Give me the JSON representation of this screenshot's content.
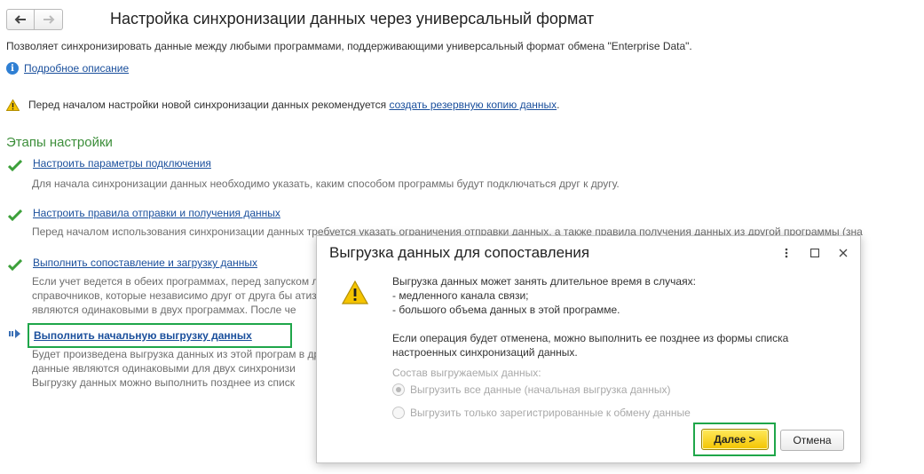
{
  "header": {
    "title": "Настройка синхронизации данных через универсальный формат",
    "description": "Позволяет синхронизировать данные между любыми программами, поддерживающими универсальный формат обмена \"Enterprise Data\".",
    "details_link": "Подробное описание"
  },
  "warning": {
    "text_before": "Перед началом настройки новой синхронизации данных рекомендуется ",
    "link": "создать резервную копию данных",
    "text_after": "."
  },
  "stages": {
    "title": "Этапы настройки",
    "items": [
      {
        "link": "Настроить параметры подключения",
        "lines": [
          "Для начала синхронизации данных необходимо указать, каким способом программы будут подключаться друг к другу."
        ]
      },
      {
        "link": "Настроить правила отправки и получения данных",
        "lines": [
          "Перед началом использования синхронизации данных требуется указать ограничения отправки данных, а также правила получения данных из другой программы (зна"
        ]
      },
      {
        "link": "Выполнить сопоставление и загрузку данных",
        "lines": [
          "Если учет ведется в обеих программах, перед запуском                                                                                               лирующихс",
          "справочников, которые независимо друг от друга бы                                                                                                 атизации можно",
          "являются одинаковыми в двух программах. После че"
        ]
      },
      {
        "link": "Выполнить начальную выгрузку данных",
        "lines": [
          "Будет произведена выгрузка данных из этой програм                                                                                                 в другой пр",
          "данные являются одинаковыми для двух синхронизи",
          "Выгрузку данных можно выполнить позднее из списк"
        ]
      }
    ]
  },
  "dialog": {
    "title": "Выгрузка данных для сопоставления",
    "message_lines": [
      "Выгрузка данных может занять длительное время в случаях:",
      " - медленного канала связи;",
      " - большого объема данных в этой программе."
    ],
    "message2_lines": [
      "Если операция будет отменена, можно выполнить ее позднее из формы списка",
      "настроенных синхронизаций данных."
    ],
    "group_label": "Состав выгружаемых данных:",
    "option_all": "Выгрузить все данные (начальная выгрузка данных)",
    "option_registered": "Выгрузить только зарегистрированные к обмену данные",
    "next_label": "Далее >",
    "cancel_label": "Отмена"
  }
}
